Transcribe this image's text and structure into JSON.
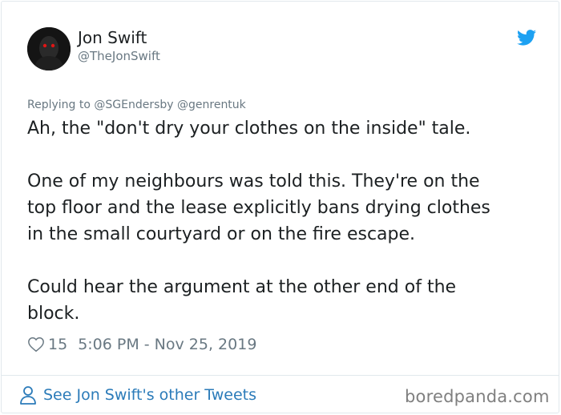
{
  "tweet": {
    "author_name": "Jon Swift",
    "author_handle": "@TheJonSwift",
    "replying_to": "Replying to @SGEndersby @genrentuk",
    "body_lines": [
      "Ah, the \"don't dry your clothes on the inside\" tale.",
      "",
      "One of my neighbours was told this. They're on the",
      "top floor and the lease explicitly bans drying clothes",
      "in the small courtyard or on the fire escape.",
      "",
      "Could hear the argument at the other end of the",
      "block."
    ],
    "like_count": "15",
    "timestamp": "5:06 PM - Nov 25, 2019"
  },
  "footer": {
    "other_tweets_link": "See Jon Swift's other Tweets",
    "watermark": "boredpanda.com"
  },
  "icons": {
    "platform": "twitter-bird-icon",
    "like": "heart-outline-icon",
    "profile": "person-outline-icon"
  },
  "colors": {
    "accent": "#1da1f2",
    "link": "#2b7bb9",
    "muted": "#697882",
    "text": "#1c2022",
    "border": "#e1e8ed"
  }
}
